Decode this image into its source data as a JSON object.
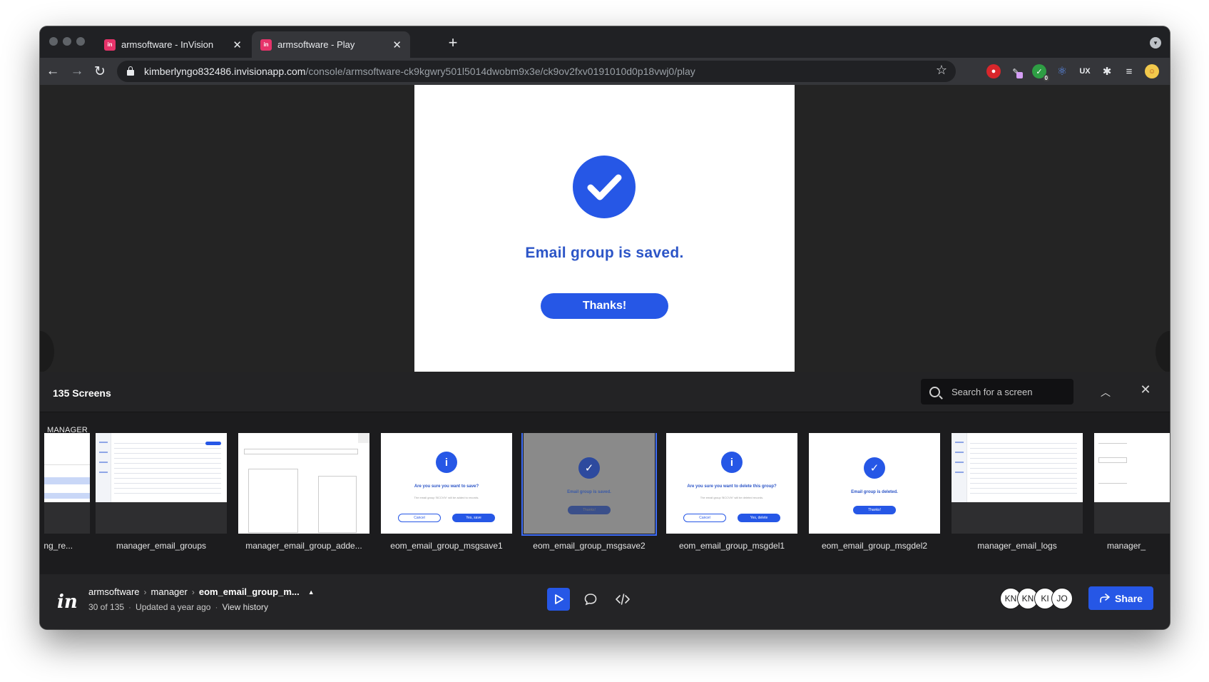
{
  "browser": {
    "tabs": [
      {
        "title": "armsoftware - InVision",
        "favicon": "invision-icon",
        "active": false
      },
      {
        "title": "armsoftware - Play",
        "favicon": "invision-icon",
        "active": true
      }
    ],
    "url_host": "kimberlyngo832486.invisionapp.com",
    "url_path": "/console/armsoftware-ck9kgwry501l5014dwobm9x3e/ck9ov2fxv0191010d0p18vwj0/play",
    "extension_badge": "0"
  },
  "prototype": {
    "message": "Email group is saved.",
    "button_label": "Thanks!",
    "accent": "#2657e6"
  },
  "drawer": {
    "screens_count": "135 Screens",
    "search_placeholder": "Search for a screen",
    "section_label": "MANAGER",
    "screens": [
      {
        "label": "ıting_re..."
      },
      {
        "label": "manager_email_groups"
      },
      {
        "label": "manager_email_group_adde..."
      },
      {
        "label": "eom_email_group_msgsave1",
        "title": "Are you sure you want to save?",
        "sub": "The email group 'BCCVIV' will be added to records.",
        "cancel": "Cancel",
        "confirm": "Yes, save"
      },
      {
        "label": "eom_email_group_msgsave2",
        "title": "Email group is saved.",
        "confirm": "Thanks!",
        "selected": true
      },
      {
        "label": "eom_email_group_msgdel1",
        "title": "Are you sure you want to delete this group?",
        "sub": "The email group 'BCCVIV' will be deleted records.",
        "cancel": "Cancel",
        "confirm": "Yes, delete"
      },
      {
        "label": "eom_email_group_msgdel2",
        "title": "Email group is deleted.",
        "confirm": "Thanks!"
      },
      {
        "label": "manager_email_logs"
      },
      {
        "label": "manager_"
      }
    ]
  },
  "footer": {
    "logo": "in",
    "breadcrumb": [
      "armsoftware",
      "manager",
      "eom_email_group_m..."
    ],
    "position": "30 of 135",
    "updated": "Updated a year ago",
    "history_link": "View history",
    "avatars": [
      "KN",
      "KN",
      "KI",
      "JO"
    ],
    "share_label": "Share"
  }
}
